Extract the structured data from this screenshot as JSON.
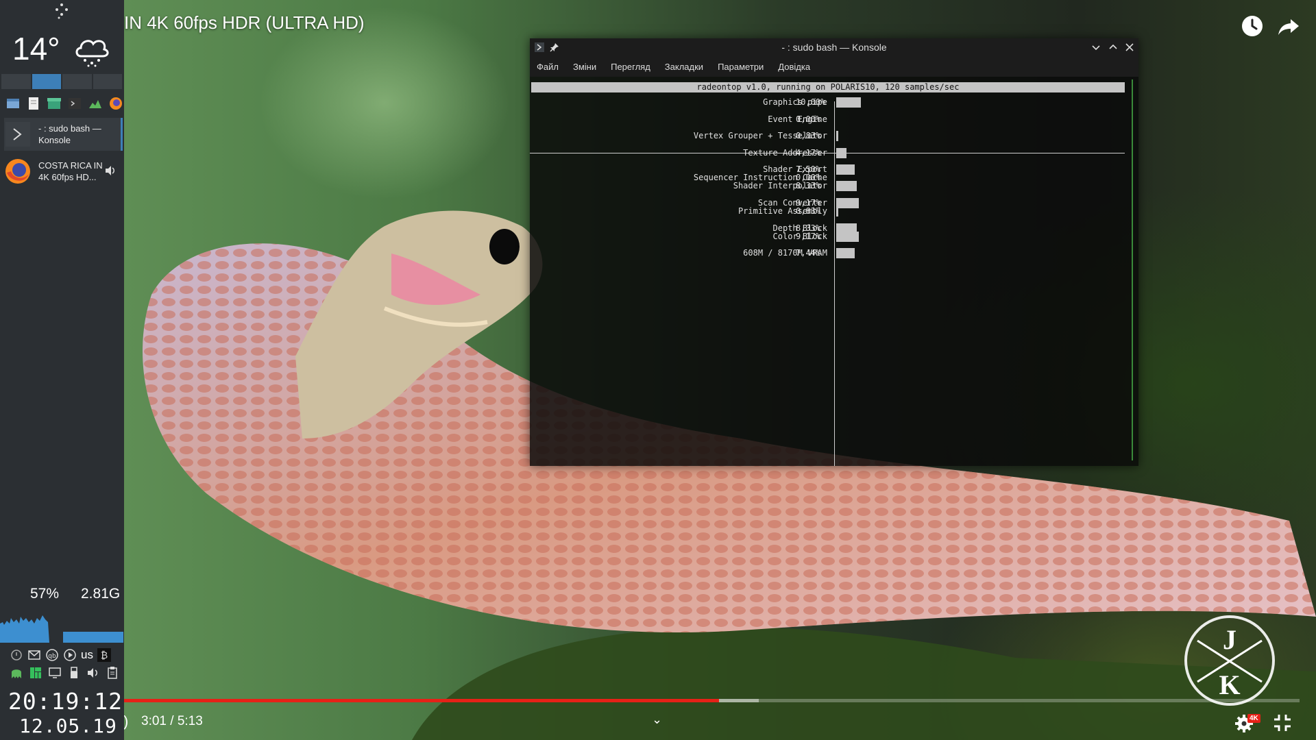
{
  "video": {
    "title": "IN 4K 60fps HDR (ULTRA HD)",
    "time": "3:01 / 5:13",
    "play_fragment": ")",
    "progress": {
      "played": 0.506,
      "buffered": 0.54
    },
    "badge": "4K",
    "watermark": {
      "top": "J",
      "bottom": "K"
    },
    "icons": [
      "watch-later-icon",
      "share-icon",
      "settings-icon",
      "exit-fullscreen-icon",
      "chevron-down-icon"
    ]
  },
  "panel": {
    "weather": {
      "temperature": "14°",
      "icon": "rain-cloud-icon"
    },
    "pager": {
      "count": 4,
      "active": 1
    },
    "launchers": [
      "file-manager-icon",
      "text-editor-icon",
      "store-icon",
      "terminal-icon",
      "system-monitor-icon",
      "firefox-icon"
    ],
    "tasks": [
      {
        "label": "- : sudo bash — Konsole",
        "icon": "konsole-icon"
      },
      {
        "label": "COSTA RICA IN 4K 60fps HD...",
        "icon": "firefox-icon"
      }
    ],
    "cpu": "57%",
    "memory": "2.81G",
    "keyboard_layout": "us",
    "clock": {
      "time": "20:19:12",
      "date": "12.05.19"
    }
  },
  "konsole": {
    "title": "- : sudo bash — Konsole",
    "menu": [
      "Файл",
      "Зміни",
      "Перегляд",
      "Закладки",
      "Параметри",
      "Довідка"
    ],
    "header": "radeontop v1.0, running on POLARIS10, 120 samples/sec",
    "rows": [
      {
        "label": "Graphics pipe",
        "pct": "10,00%",
        "value": 10.0
      },
      {
        "label": "Event Engine",
        "pct": "0,00%",
        "value": 0.0
      },
      {
        "label": "Vertex Grouper + Tesselator",
        "pct": "0,83%",
        "value": 0.83
      },
      {
        "label": "Texture Addresser",
        "pct": "4,17%",
        "value": 4.17
      },
      {
        "label": "Shader Export",
        "pct": "7,50%",
        "value": 7.5
      },
      {
        "label": "Sequencer Instruction Cache",
        "pct": "0,00%",
        "value": 0.0
      },
      {
        "label": "Shader Interpolator",
        "pct": "8,33%",
        "value": 8.33
      },
      {
        "label": "Scan Converter",
        "pct": "9,17%",
        "value": 9.17
      },
      {
        "label": "Primitive Assembly",
        "pct": "0,83%",
        "value": 0.83
      },
      {
        "label": "Depth Block",
        "pct": "8,33%",
        "value": 8.33
      },
      {
        "label": "Color Block",
        "pct": "9,17%",
        "value": 9.17
      },
      {
        "label": "608M / 8170M VRAM",
        "pct": "7,44%",
        "value": 7.44
      }
    ]
  }
}
